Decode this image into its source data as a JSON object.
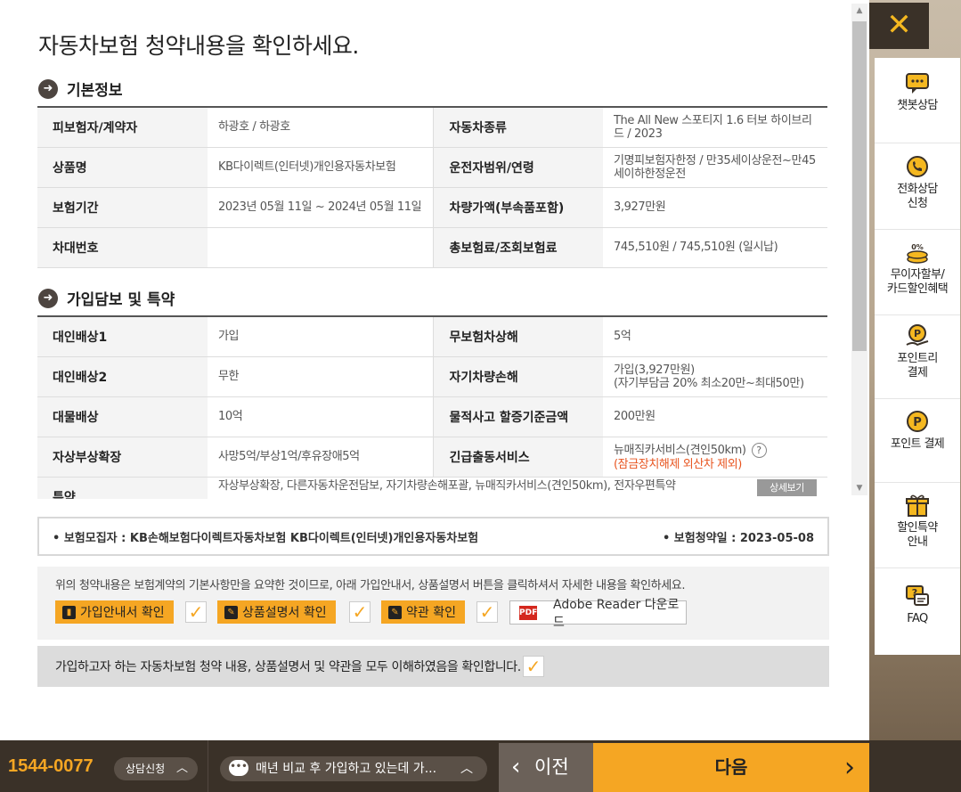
{
  "title": "자동차보험 청약내용을 확인하세요.",
  "sections": {
    "basic": {
      "heading": "기본정보",
      "rows": [
        {
          "l1": "피보험자/계약자",
          "v1": "하광호 / 하광호",
          "l2": "자동차종류",
          "v2": "The All New 스포티지 1.6 터보 하이브리드 / 2023"
        },
        {
          "l1": "상품명",
          "v1": "KB다이렉트(인터넷)개인용자동차보험",
          "l2": "운전자범위/연령",
          "v2": "기명피보험자한정 / 만35세이상운전~만45세이하한정운전"
        },
        {
          "l1": "보험기간",
          "v1": "2023년 05월 11일 ~ 2024년 05월 11일",
          "l2": "차량가액(부속품포함)",
          "v2": "3,927만원"
        },
        {
          "l1": "차대번호",
          "v1": "",
          "l2": "총보험료/조회보험료",
          "v2": "745,510원 / 745,510원 (일시납)"
        }
      ]
    },
    "coverage": {
      "heading": "가입담보 및 특약",
      "rows": [
        {
          "l1": "대인배상1",
          "v1": "가입",
          "l2": "무보험차상해",
          "v2": "5억"
        },
        {
          "l1": "대인배상2",
          "v1": "무한",
          "l2": "자기차량손해",
          "v2": "가입(3,927만원)",
          "v2b": "(자기부담금 20% 최소20만~최대50만)"
        },
        {
          "l1": "대물배상",
          "v1": "10억",
          "l2": "물적사고 할증기준금액",
          "v2": "200만원"
        },
        {
          "l1": "자상부상확장",
          "v1": "사망5억/부상1억/후유장애5억",
          "l2": "긴급출동서비스",
          "v2": "뉴매직카서비스(견인50km)",
          "v2b": "(잠금장치해제 외산차 제외)"
        },
        {
          "l1": "특약",
          "v1": "자상부상확장, 다른자동차운전담보, 자기차량손해포괄, 뉴매직카서비스(견인50km), 전자우편특약"
        }
      ],
      "detail_label": "상세보기"
    }
  },
  "recruiter": {
    "left": "• 보험모집자 : KB손해보험다이렉트자동차보험 KB다이렉트(인터넷)개인용자동차보험",
    "right": "• 보험청약일 : 2023-05-08"
  },
  "confirm": {
    "desc": "위의 청약내용은 보험계약의 기본사항만을 요약한 것이므로, 아래 가입안내서, 상품설명서 버튼을 클릭하셔서 자세한 내용을 확인하세요.",
    "btn_guide": "가입안내서 확인",
    "btn_desc": "상품설명서 확인",
    "btn_terms": "약관 확인",
    "btn_pdf": "Adobe Reader 다운로드",
    "check": "✓"
  },
  "agree_text": "가입하고자 하는 자동차보험 청약 내용, 상품설명서 및 약관을 모두 이해하였음을 확인합니다.",
  "close_label": "✕",
  "sidebar": [
    {
      "label": "챗봇상담",
      "icon": "chatbot-icon"
    },
    {
      "label": "전화상담\n신청",
      "icon": "phone-icon"
    },
    {
      "label": "무이자할부/\n카드할인혜택",
      "icon": "coins-icon"
    },
    {
      "label": "포인트리\n결제",
      "icon": "point-hand-icon"
    },
    {
      "label": "포인트 결제",
      "icon": "point-icon"
    },
    {
      "label": "할인특약\n안내",
      "icon": "gift-icon"
    },
    {
      "label": "FAQ",
      "icon": "faq-icon"
    }
  ],
  "bottom": {
    "phone": "1544-0077",
    "consult": "상담신청",
    "chat": "매년 비교 후 가입하고 있는데 가...",
    "prev": "이전",
    "next": "다음"
  },
  "colors": {
    "accent": "#f5a623",
    "dark": "#3a3128",
    "warning": "#e85520"
  }
}
